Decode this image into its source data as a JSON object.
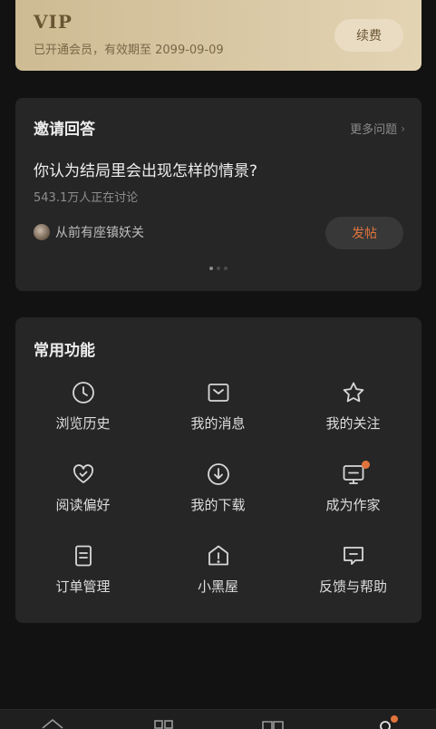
{
  "vip": {
    "title": "VIP",
    "subtitle": "已开通会员，有效期至 2099-09-09",
    "renew_label": "续费"
  },
  "invite": {
    "title": "邀请回答",
    "more_label": "更多问题",
    "question": "你认为结局里会出现怎样的情景?",
    "discuss": "543.1万人正在讨论",
    "author": "从前有座镇妖关",
    "post_label": "发帖",
    "page_dots": 3,
    "active_dot": 0
  },
  "features": {
    "title": "常用功能",
    "items": [
      {
        "label": "浏览历史",
        "icon": "clock-icon"
      },
      {
        "label": "我的消息",
        "icon": "message-box-icon"
      },
      {
        "label": "我的关注",
        "icon": "star-icon"
      },
      {
        "label": "阅读偏好",
        "icon": "heart-check-icon"
      },
      {
        "label": "我的下载",
        "icon": "download-icon"
      },
      {
        "label": "成为作家",
        "icon": "monitor-icon",
        "badge": true
      },
      {
        "label": "订单管理",
        "icon": "order-doc-icon"
      },
      {
        "label": "小黑屋",
        "icon": "house-alert-icon"
      },
      {
        "label": "反馈与帮助",
        "icon": "feedback-icon"
      }
    ]
  },
  "bottom_nav": {
    "items": [
      "home-icon",
      "category-icon",
      "bookshelf-icon",
      "profile-icon"
    ]
  },
  "colors": {
    "accent": "#e0743c",
    "card": "#262626",
    "background": "#121212",
    "vip_gold": "#cdbb93"
  }
}
